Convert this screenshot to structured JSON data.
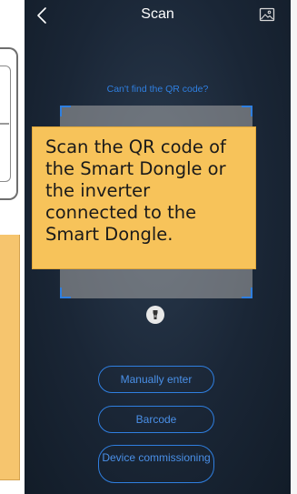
{
  "header": {
    "title": "Scan"
  },
  "icons": {
    "back": "chevron-left-icon",
    "gallery": "image-icon",
    "flashlight": "flashlight-icon"
  },
  "scan": {
    "cant_find_link": "Can't find the QR code?",
    "callout_text": "Scan the QR code of the Smart Dongle or the inverter connected to the Smart Dongle."
  },
  "actions": {
    "manually_enter": "Manually enter",
    "barcode": "Barcode",
    "device_commissioning": "Device commissioning"
  },
  "colors": {
    "accent_blue": "#2f7fe0",
    "callout_orange": "#f7c35a",
    "background_dark": "#1a2636"
  }
}
